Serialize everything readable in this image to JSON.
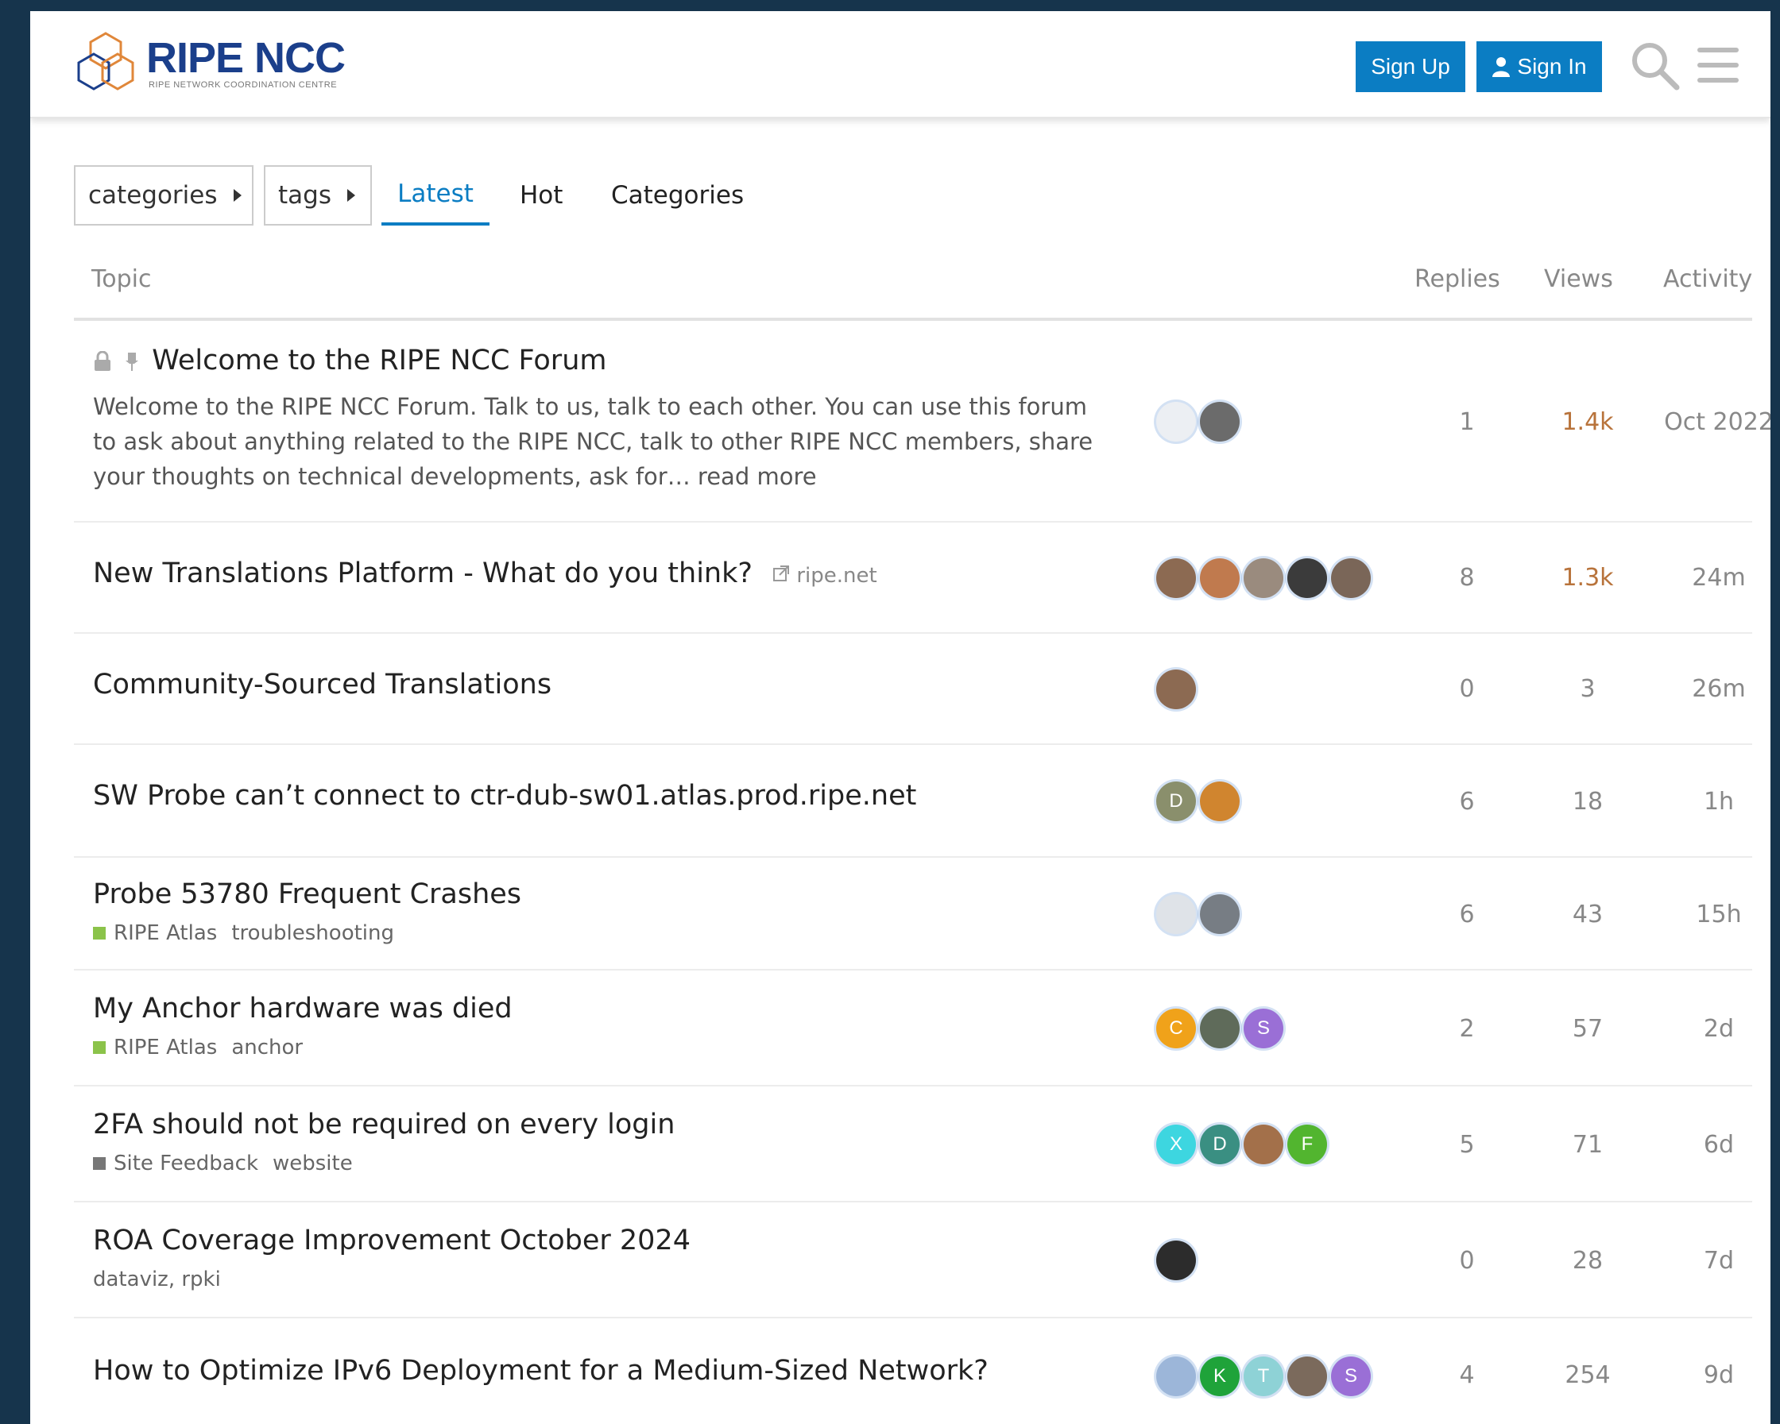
{
  "header": {
    "logo_title": "RIPE NCC",
    "logo_subtitle": "RIPE NETWORK COORDINATION CENTRE",
    "signup_label": "Sign Up",
    "signin_label": "Sign In"
  },
  "nav": {
    "categories_label": "categories",
    "tags_label": "tags",
    "tabs": [
      {
        "label": "Latest",
        "active": true
      },
      {
        "label": "Hot"
      },
      {
        "label": "Categories"
      }
    ]
  },
  "table": {
    "columns": {
      "topic": "Topic",
      "replies": "Replies",
      "views": "Views",
      "activity": "Activity"
    },
    "rows": [
      {
        "title": "Welcome to the RIPE NCC Forum",
        "excerpt": "Welcome to the RIPE NCC Forum. Talk to us, talk to each other. You can use this forum to ask about anything related to the RIPE NCC, talk to other RIPE NCC members, share your thoughts on technical developments, ask for… read more",
        "replies": "1",
        "views": "1.4k",
        "activity": "Oct 2022"
      },
      {
        "title": "New Translations Platform - What do you think?",
        "link": "ripe.net",
        "replies": "8",
        "views": "1.3k",
        "activity": "24m"
      },
      {
        "title": "Community-Sourced Translations",
        "replies": "0",
        "views": "3",
        "activity": "26m"
      },
      {
        "title": "SW Probe can’t connect to ctr-dub-sw01.atlas.prod.ripe.net",
        "replies": "6",
        "views": "18",
        "activity": "1h",
        "avatars": [
          "D"
        ]
      },
      {
        "title": "Probe 53780 Frequent Crashes",
        "category": "RIPE Atlas",
        "tags": [
          "troubleshooting"
        ],
        "replies": "6",
        "views": "43",
        "activity": "15h"
      },
      {
        "title": "My Anchor hardware was died",
        "category": "RIPE Atlas",
        "tags": [
          "anchor"
        ],
        "replies": "2",
        "views": "57",
        "activity": "2d",
        "avatars": [
          "C",
          "S"
        ]
      },
      {
        "title": "2FA should not be required on every login",
        "category": "Site Feedback",
        "tags": [
          "website"
        ],
        "replies": "5",
        "views": "71",
        "activity": "6d",
        "avatars": [
          "X",
          "D",
          "F"
        ]
      },
      {
        "title": "ROA Coverage Improvement October 2024",
        "tags_line": "dataviz, rpki",
        "replies": "0",
        "views": "28",
        "activity": "7d"
      },
      {
        "title": "How to Optimize IPv6 Deployment for a Medium-Sized Network?",
        "replies": "4",
        "views": "254",
        "activity": "9d",
        "avatars": [
          "K",
          "T",
          "S"
        ]
      }
    ]
  },
  "colors": {
    "brand_blue": "#0b7dc3",
    "logo_navy": "#1b3f8b",
    "hot_views": "#b8733b",
    "category_green": "#8bc34a",
    "category_grey": "#777777"
  }
}
